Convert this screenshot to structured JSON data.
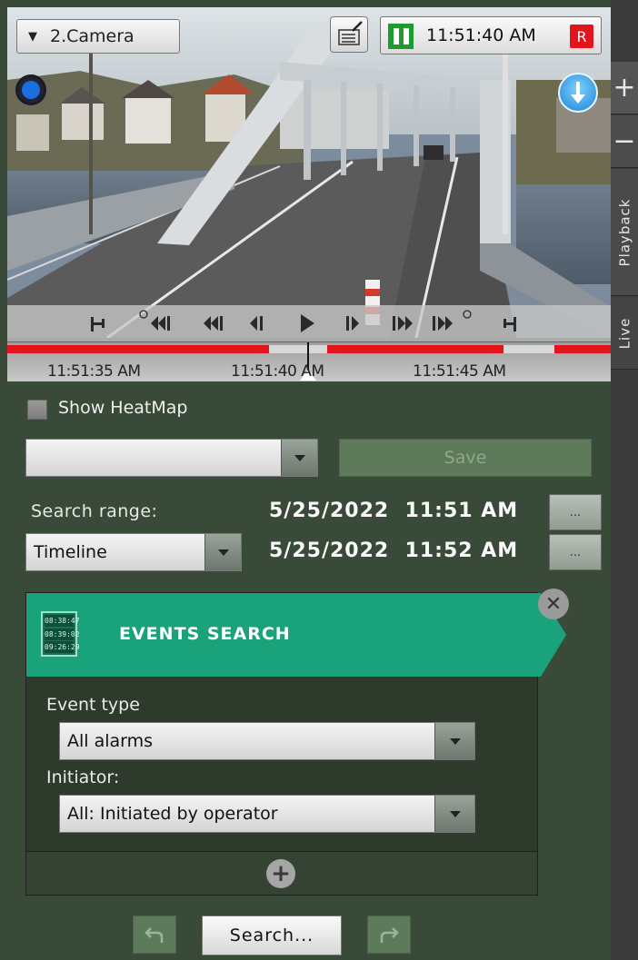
{
  "camera": {
    "name": "2.Camera",
    "time": "11:51:40 AM",
    "record_badge": "R"
  },
  "side_strip": {
    "zoom_in": "+",
    "zoom_out": "−",
    "tab_playback": "Playback",
    "tab_live": "Live"
  },
  "timeline": {
    "ticks": [
      "11:51:35 AM",
      "11:51:40 AM",
      "11:51:45 AM"
    ],
    "colors": {
      "alarm": "#e3151c",
      "gap": "#d8d8d8"
    }
  },
  "panel": {
    "heatmap_label": "Show HeatMap",
    "heatmap_checked": false,
    "preset_value": "",
    "save_label": "Save",
    "search_range_label": "Search range:",
    "range_start": "5/25/2022  11:51 AM",
    "range_end": "5/25/2022  11:52 AM",
    "range_mode": "Timeline",
    "picker_label": "...",
    "events_card": {
      "title": "EVENTS SEARCH",
      "icon_times": [
        "08:38:47",
        "08:39:02",
        "09:26:29"
      ],
      "event_type_label": "Event type",
      "event_type_value": "All alarms",
      "initiator_label": "Initiator:",
      "initiator_value": "All: Initiated by operator",
      "accent": "#1aa37a"
    },
    "search_label": "Search..."
  },
  "icons": [
    "dropdown-triangle-icon",
    "edit-note-icon",
    "pause-icon",
    "status-dot-icon",
    "download-arrow-icon",
    "close-icon",
    "add-icon",
    "undo-icon",
    "redo-icon"
  ]
}
